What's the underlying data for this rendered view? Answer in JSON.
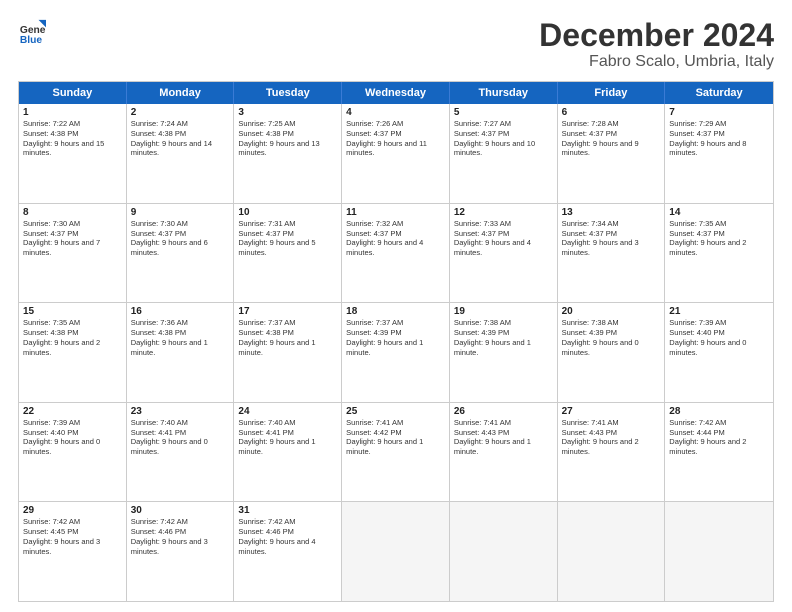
{
  "logo": {
    "line1": "General",
    "line2": "Blue"
  },
  "title": "December 2024",
  "subtitle": "Fabro Scalo, Umbria, Italy",
  "header": {
    "days": [
      "Sunday",
      "Monday",
      "Tuesday",
      "Wednesday",
      "Thursday",
      "Friday",
      "Saturday"
    ]
  },
  "rows": [
    [
      {
        "day": "1",
        "text": "Sunrise: 7:22 AM\nSunset: 4:38 PM\nDaylight: 9 hours and 15 minutes."
      },
      {
        "day": "2",
        "text": "Sunrise: 7:24 AM\nSunset: 4:38 PM\nDaylight: 9 hours and 14 minutes."
      },
      {
        "day": "3",
        "text": "Sunrise: 7:25 AM\nSunset: 4:38 PM\nDaylight: 9 hours and 13 minutes."
      },
      {
        "day": "4",
        "text": "Sunrise: 7:26 AM\nSunset: 4:37 PM\nDaylight: 9 hours and 11 minutes."
      },
      {
        "day": "5",
        "text": "Sunrise: 7:27 AM\nSunset: 4:37 PM\nDaylight: 9 hours and 10 minutes."
      },
      {
        "day": "6",
        "text": "Sunrise: 7:28 AM\nSunset: 4:37 PM\nDaylight: 9 hours and 9 minutes."
      },
      {
        "day": "7",
        "text": "Sunrise: 7:29 AM\nSunset: 4:37 PM\nDaylight: 9 hours and 8 minutes."
      }
    ],
    [
      {
        "day": "8",
        "text": "Sunrise: 7:30 AM\nSunset: 4:37 PM\nDaylight: 9 hours and 7 minutes."
      },
      {
        "day": "9",
        "text": "Sunrise: 7:30 AM\nSunset: 4:37 PM\nDaylight: 9 hours and 6 minutes."
      },
      {
        "day": "10",
        "text": "Sunrise: 7:31 AM\nSunset: 4:37 PM\nDaylight: 9 hours and 5 minutes."
      },
      {
        "day": "11",
        "text": "Sunrise: 7:32 AM\nSunset: 4:37 PM\nDaylight: 9 hours and 4 minutes."
      },
      {
        "day": "12",
        "text": "Sunrise: 7:33 AM\nSunset: 4:37 PM\nDaylight: 9 hours and 4 minutes."
      },
      {
        "day": "13",
        "text": "Sunrise: 7:34 AM\nSunset: 4:37 PM\nDaylight: 9 hours and 3 minutes."
      },
      {
        "day": "14",
        "text": "Sunrise: 7:35 AM\nSunset: 4:37 PM\nDaylight: 9 hours and 2 minutes."
      }
    ],
    [
      {
        "day": "15",
        "text": "Sunrise: 7:35 AM\nSunset: 4:38 PM\nDaylight: 9 hours and 2 minutes."
      },
      {
        "day": "16",
        "text": "Sunrise: 7:36 AM\nSunset: 4:38 PM\nDaylight: 9 hours and 1 minute."
      },
      {
        "day": "17",
        "text": "Sunrise: 7:37 AM\nSunset: 4:38 PM\nDaylight: 9 hours and 1 minute."
      },
      {
        "day": "18",
        "text": "Sunrise: 7:37 AM\nSunset: 4:39 PM\nDaylight: 9 hours and 1 minute."
      },
      {
        "day": "19",
        "text": "Sunrise: 7:38 AM\nSunset: 4:39 PM\nDaylight: 9 hours and 1 minute."
      },
      {
        "day": "20",
        "text": "Sunrise: 7:38 AM\nSunset: 4:39 PM\nDaylight: 9 hours and 0 minutes."
      },
      {
        "day": "21",
        "text": "Sunrise: 7:39 AM\nSunset: 4:40 PM\nDaylight: 9 hours and 0 minutes."
      }
    ],
    [
      {
        "day": "22",
        "text": "Sunrise: 7:39 AM\nSunset: 4:40 PM\nDaylight: 9 hours and 0 minutes."
      },
      {
        "day": "23",
        "text": "Sunrise: 7:40 AM\nSunset: 4:41 PM\nDaylight: 9 hours and 0 minutes."
      },
      {
        "day": "24",
        "text": "Sunrise: 7:40 AM\nSunset: 4:41 PM\nDaylight: 9 hours and 1 minute."
      },
      {
        "day": "25",
        "text": "Sunrise: 7:41 AM\nSunset: 4:42 PM\nDaylight: 9 hours and 1 minute."
      },
      {
        "day": "26",
        "text": "Sunrise: 7:41 AM\nSunset: 4:43 PM\nDaylight: 9 hours and 1 minute."
      },
      {
        "day": "27",
        "text": "Sunrise: 7:41 AM\nSunset: 4:43 PM\nDaylight: 9 hours and 2 minutes."
      },
      {
        "day": "28",
        "text": "Sunrise: 7:42 AM\nSunset: 4:44 PM\nDaylight: 9 hours and 2 minutes."
      }
    ],
    [
      {
        "day": "29",
        "text": "Sunrise: 7:42 AM\nSunset: 4:45 PM\nDaylight: 9 hours and 3 minutes."
      },
      {
        "day": "30",
        "text": "Sunrise: 7:42 AM\nSunset: 4:46 PM\nDaylight: 9 hours and 3 minutes."
      },
      {
        "day": "31",
        "text": "Sunrise: 7:42 AM\nSunset: 4:46 PM\nDaylight: 9 hours and 4 minutes."
      },
      {
        "day": "",
        "text": ""
      },
      {
        "day": "",
        "text": ""
      },
      {
        "day": "",
        "text": ""
      },
      {
        "day": "",
        "text": ""
      }
    ]
  ]
}
